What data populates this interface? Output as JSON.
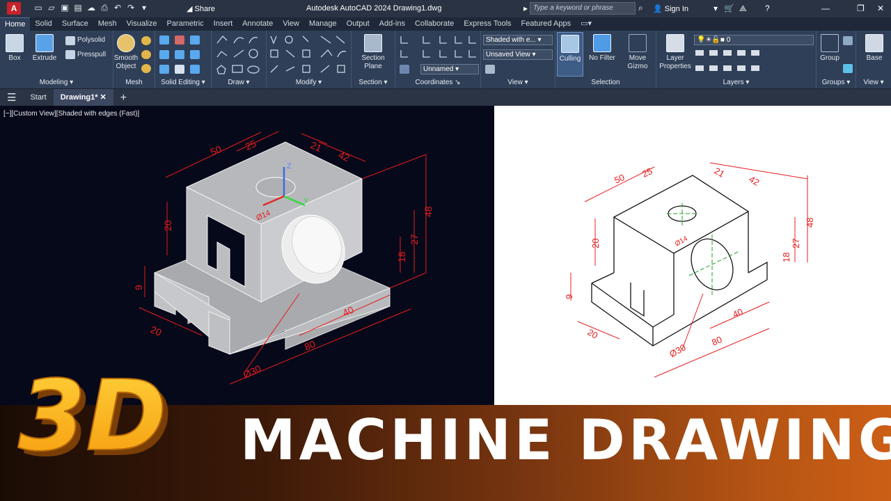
{
  "titlebar": {
    "logo": "A",
    "share_label": "Share",
    "title": "Autodesk AutoCAD 2024   Drawing1.dwg",
    "search_placeholder": "Type a keyword or phrase",
    "signin_label": "Sign In"
  },
  "ribbon_tabs": [
    "Home",
    "Solid",
    "Surface",
    "Mesh",
    "Visualize",
    "Parametric",
    "Insert",
    "Annotate",
    "View",
    "Manage",
    "Output",
    "Add-ins",
    "Collaborate",
    "Express Tools",
    "Featured Apps"
  ],
  "panels": {
    "modeling": {
      "title": "Modeling",
      "box": "Box",
      "extrude": "Extrude",
      "polysolid": "Polysolid",
      "presspull": "Presspull"
    },
    "mesh": {
      "title": "Mesh",
      "smooth": "Smooth",
      "object": "Object"
    },
    "solid_editing": {
      "title": "Solid Editing"
    },
    "draw": {
      "title": "Draw"
    },
    "modify": {
      "title": "Modify"
    },
    "section": {
      "title": "Section",
      "plane1": "Section",
      "plane2": "Plane"
    },
    "coordinates": {
      "title": "Coordinates",
      "ucs": "Unnamed"
    },
    "view": {
      "title": "View",
      "visual_style": "Shaded with e...",
      "saved_view": "Unsaved View"
    },
    "selection": {
      "title": "Selection",
      "culling": "Culling",
      "nofilter": "No Filter",
      "gizmo1": "Move",
      "gizmo2": "Gizmo"
    },
    "layers": {
      "title": "Layers",
      "props1": "Layer",
      "props2": "Properties",
      "current": "0"
    },
    "groups": {
      "title": "Groups",
      "group": "Group"
    },
    "view2": {
      "title": "View",
      "base": "Base"
    }
  },
  "doc_tabs": {
    "start": "Start",
    "drawing": "Drawing1*"
  },
  "viewport": {
    "label": "[−][Custom View][Shaded with edges (Fast)]",
    "dims": {
      "d50": "50",
      "d25": "25",
      "d21": "21",
      "d42": "42",
      "d48": "48",
      "d27": "27",
      "d18": "18",
      "d20": "20",
      "d9": "9",
      "d40": "40",
      "d80": "80",
      "d30": "Ø30",
      "d14": "Ø14",
      "d20b": "20"
    },
    "ucs": {
      "x": "X",
      "y": "Y",
      "z": "Z"
    }
  },
  "banner": {
    "title": "MACHINE DRAWING",
    "logo": "3D"
  },
  "colors": {
    "dim": "#e81c1c",
    "accent": "#2e3f57",
    "titlebar": "#2a3344"
  }
}
